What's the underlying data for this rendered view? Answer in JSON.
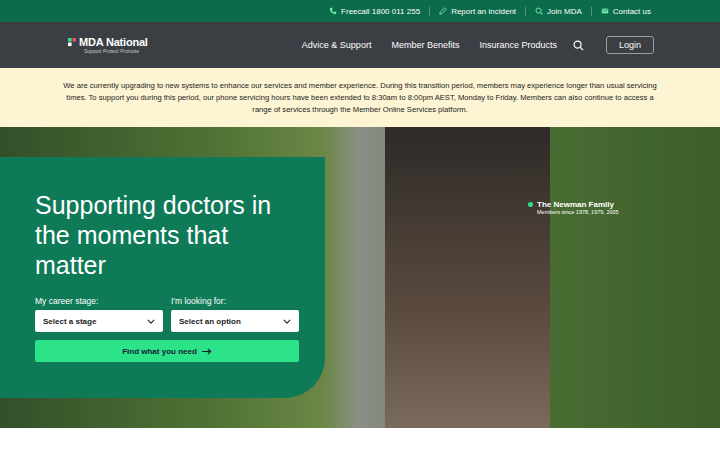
{
  "utility_bar": [
    "Freecall 1800 011 255",
    "Report an incident",
    "Join MDA",
    "Contact us"
  ],
  "logo": {
    "name": "MDA National",
    "tagline": "Support Protect Promote"
  },
  "nav": [
    "Advice & Support",
    "Member Benefits",
    "Insurance Products"
  ],
  "login": "Login",
  "notice": "We are currently upgrading to new systems to enhance our services and member experience. During this transition period, members may experience longer than usual servicing times. To support you during this period, our phone servicing hours have been extended to 8:30am to 8:00pm AEST, Monday to Friday. Members can also continue to access a range of services through the Member Online Services platform.",
  "hero": {
    "title": "Supporting doctors in the moments that matter",
    "fields": [
      {
        "label": "My career stage:",
        "placeholder": "Select a stage"
      },
      {
        "label": "I'm looking for:",
        "placeholder": "Select an option"
      }
    ],
    "button": "Find what you need"
  },
  "caption": {
    "name": "The Newman Family",
    "detail": "Members since 1978, 1979, 2005"
  }
}
